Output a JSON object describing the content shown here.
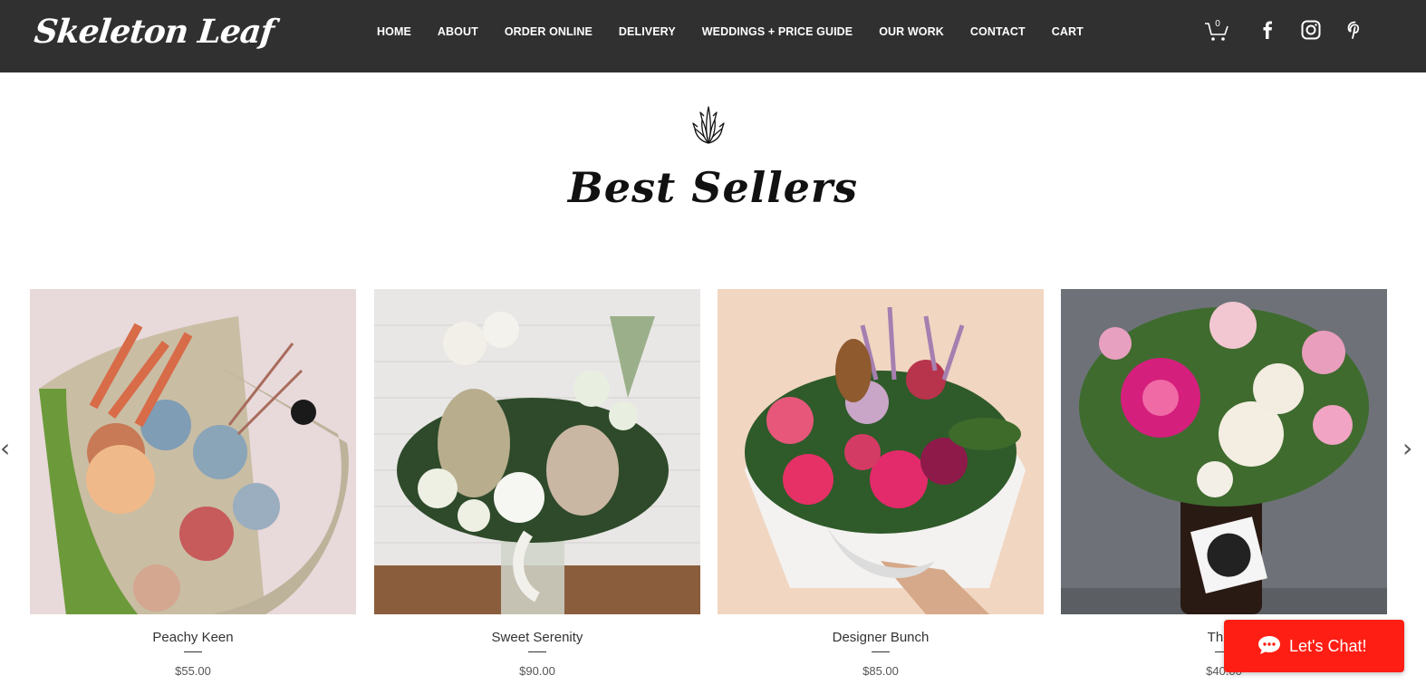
{
  "header": {
    "logo_text": "Skeleton Leaf",
    "nav": [
      "HOME",
      "ABOUT",
      "ORDER ONLINE",
      "DELIVERY",
      "WEDDINGS + PRICE GUIDE",
      "OUR WORK",
      "CONTACT",
      "CART"
    ],
    "cart_count": "0",
    "icons": [
      "cart-icon",
      "facebook-icon",
      "instagram-icon",
      "pinterest-icon"
    ],
    "background_color": "#303030"
  },
  "section": {
    "icon": "protea-flower-icon",
    "title": "Best Sellers"
  },
  "gallery": {
    "prev_arrow": "‹",
    "next_arrow": "›",
    "products": [
      {
        "name": "Peachy Keen",
        "price": "$55.00"
      },
      {
        "name": "Sweet Serenity",
        "price": "$90.00"
      },
      {
        "name": "Designer Bunch",
        "price": "$85.00"
      },
      {
        "name": "Think",
        "price": "$40.00"
      }
    ]
  },
  "chat": {
    "label": "Let's Chat!",
    "icon": "chat-bubble-icon",
    "color": "#ff1e14"
  }
}
